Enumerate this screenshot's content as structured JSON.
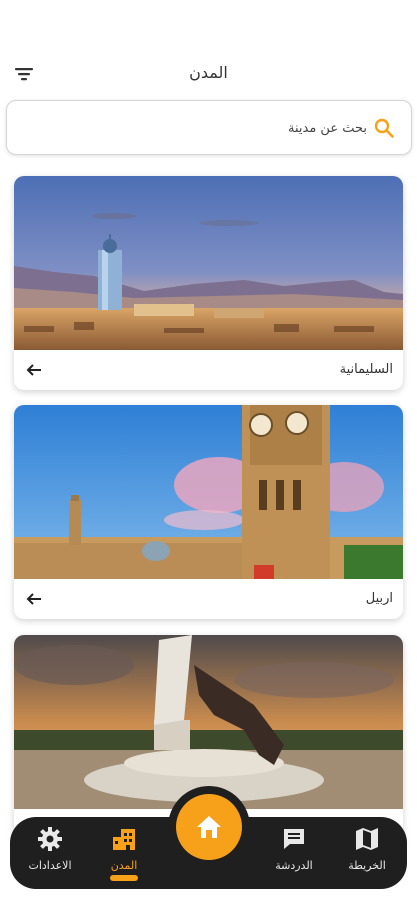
{
  "header": {
    "title": "المدن",
    "filter_icon": "filter-icon"
  },
  "search": {
    "placeholder": "بحث عن مدينة",
    "icon": "search-icon",
    "accent": "#f7a11a"
  },
  "cities": [
    {
      "name": "السليمانية",
      "action_icon": "arrow-left-icon"
    },
    {
      "name": "اربيل",
      "action_icon": "arrow-left-icon"
    },
    {
      "name": "",
      "action_icon": "arrow-left-icon"
    }
  ],
  "nav": {
    "items": [
      {
        "label": "الاعدادات",
        "icon": "gear-icon",
        "active": false
      },
      {
        "label": "المدن",
        "icon": "city-buildings-icon",
        "active": true
      },
      {
        "label": "الدردشة",
        "icon": "chat-icon",
        "active": false
      },
      {
        "label": "الخريطة",
        "icon": "map-icon",
        "active": false
      }
    ],
    "home_icon": "home-icon"
  },
  "colors": {
    "accent": "#f7a11a",
    "nav_bg": "#1f1f1f"
  }
}
